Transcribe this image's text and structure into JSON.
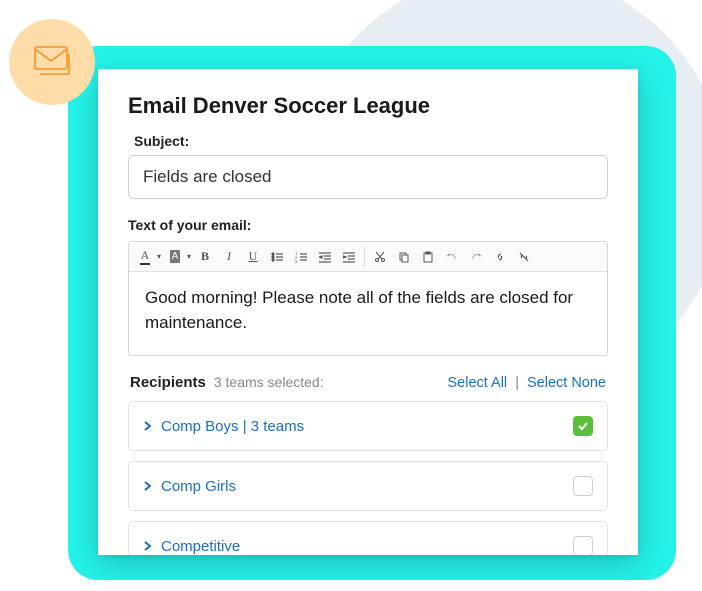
{
  "title": "Email Denver Soccer League",
  "subject": {
    "label": "Subject:",
    "value": "Fields are closed"
  },
  "body": {
    "label": "Text of your email:",
    "text": "Good morning! Please note all of the fields are closed for maintenance."
  },
  "recipients": {
    "label": "Recipients",
    "count_text": "3 teams selected:",
    "select_all": "Select All",
    "select_none": "Select None",
    "rows": [
      {
        "label": "Comp Boys | 3 teams",
        "checked": true
      },
      {
        "label": "Comp Girls",
        "checked": false
      },
      {
        "label": "Competitive",
        "checked": false
      }
    ]
  }
}
